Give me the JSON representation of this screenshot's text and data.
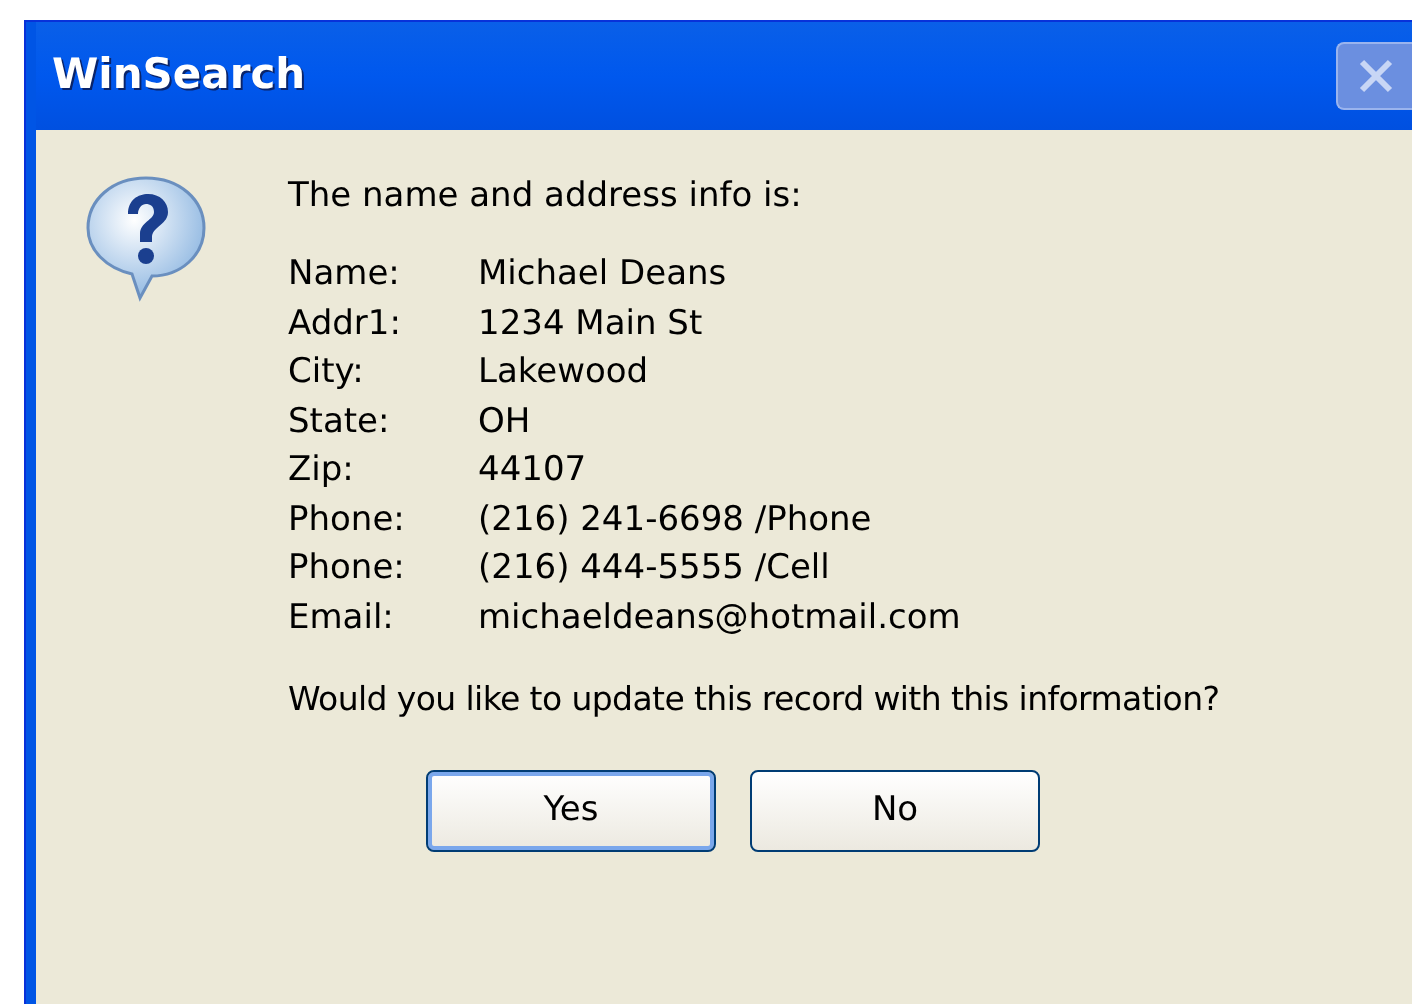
{
  "window": {
    "title": "WinSearch"
  },
  "message": {
    "intro": "The name and address info is:",
    "fields": [
      {
        "label": "Name:",
        "value": "Michael Deans"
      },
      {
        "label": "Addr1:",
        "value": "1234 Main St"
      },
      {
        "label": "City:",
        "value": "Lakewood"
      },
      {
        "label": "State:",
        "value": "OH"
      },
      {
        "label": "Zip:",
        "value": "44107"
      },
      {
        "label": "Phone:",
        "value": "(216) 241-6698 /Phone"
      },
      {
        "label": "Phone:",
        "value": "(216) 444-5555 /Cell"
      },
      {
        "label": "Email:",
        "value": "michaeldeans@hotmail.com"
      }
    ],
    "question": "Would you like to update this record with this information?"
  },
  "buttons": [
    {
      "label": "Yes",
      "selected": true
    },
    {
      "label": "No",
      "selected": false
    }
  ]
}
